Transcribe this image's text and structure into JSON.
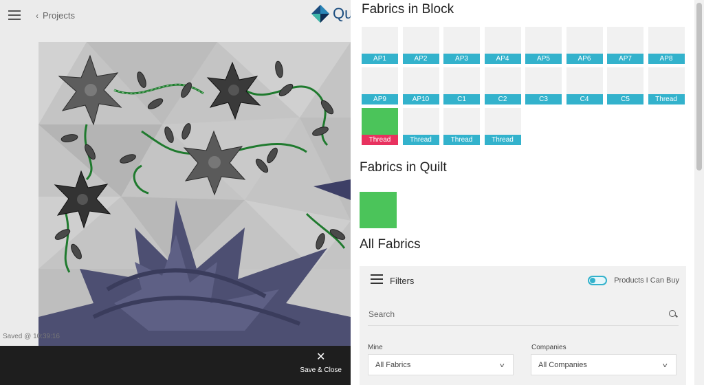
{
  "header": {
    "back_label": "Projects",
    "logo_text": "Qu"
  },
  "status": {
    "saved": "Saved @ 10:39:16"
  },
  "bottom": {
    "save_close_label": "Save & Close"
  },
  "panel": {
    "block_title": "Fabrics in Block",
    "quilt_title": "Fabrics in Quilt",
    "all_title": "All Fabrics",
    "block_tiles": [
      {
        "label": "AP1",
        "fill": "#f1f1f1"
      },
      {
        "label": "AP2",
        "fill": "#f1f1f1"
      },
      {
        "label": "AP3",
        "fill": "#f1f1f1"
      },
      {
        "label": "AP4",
        "fill": "#f1f1f1"
      },
      {
        "label": "AP5",
        "fill": "#f1f1f1"
      },
      {
        "label": "AP6",
        "fill": "#f1f1f1"
      },
      {
        "label": "AP7",
        "fill": "#f1f1f1"
      },
      {
        "label": "AP8",
        "fill": "#f1f1f1"
      },
      {
        "label": "AP9",
        "fill": "#f1f1f1"
      },
      {
        "label": "AP10",
        "fill": "#f1f1f1"
      },
      {
        "label": "C1",
        "fill": "#f1f1f1"
      },
      {
        "label": "C2",
        "fill": "#f1f1f1"
      },
      {
        "label": "C3",
        "fill": "#f1f1f1"
      },
      {
        "label": "C4",
        "fill": "#f1f1f1"
      },
      {
        "label": "C5",
        "fill": "#f1f1f1"
      },
      {
        "label": "Thread",
        "fill": "#f1f1f1"
      },
      {
        "label": "Thread",
        "fill": "#4bc45a",
        "selected": true
      },
      {
        "label": "Thread",
        "fill": "#f1f1f1"
      },
      {
        "label": "Thread",
        "fill": "#f1f1f1"
      },
      {
        "label": "Thread",
        "fill": "#f1f1f1"
      }
    ],
    "filters_label": "Filters",
    "toggle_label": "Products I Can Buy",
    "search_placeholder": "Search",
    "mine_label": "Mine",
    "mine_value": "All Fabrics",
    "companies_label": "Companies",
    "companies_value": "All Companies"
  },
  "colors": {
    "accent": "#33b2cc",
    "selected": "#e8325f",
    "fabric_green": "#4bc45a",
    "bottom_bar": "#1e1e1e"
  }
}
